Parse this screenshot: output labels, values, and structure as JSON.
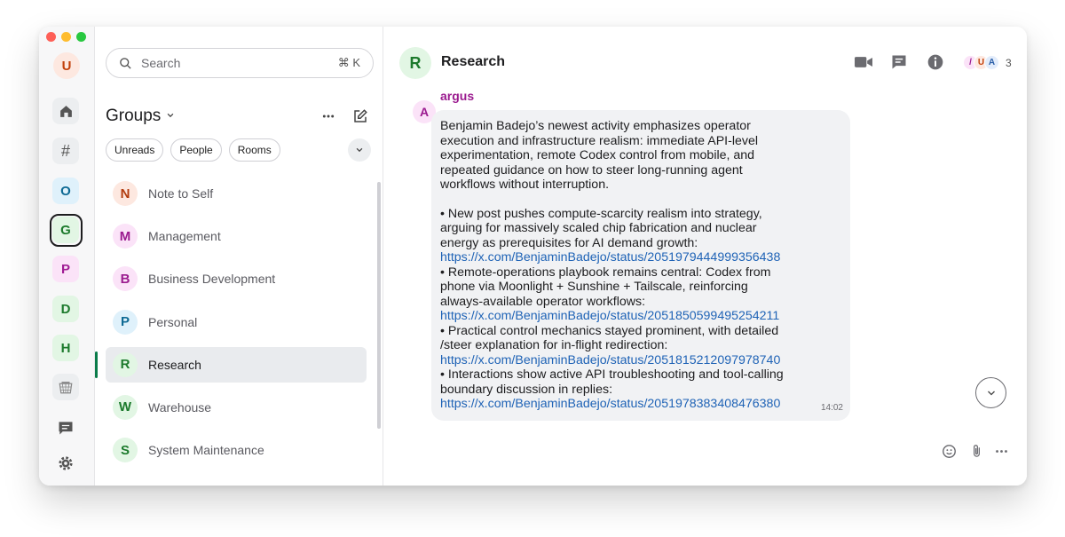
{
  "rail": {
    "user_initial": "U",
    "spaces": [
      {
        "initial": "O"
      },
      {
        "initial": "G"
      },
      {
        "initial": "P"
      },
      {
        "initial": "D"
      },
      {
        "initial": "H"
      }
    ],
    "hash_glyph": "#"
  },
  "sidebar": {
    "search": {
      "placeholder": "Search",
      "shortcut": "⌘ K"
    },
    "title": "Groups",
    "filters": [
      "Unreads",
      "People",
      "Rooms"
    ],
    "rooms": [
      {
        "initial": "N",
        "name": "Note to Self"
      },
      {
        "initial": "M",
        "name": "Management"
      },
      {
        "initial": "B",
        "name": "Business Development"
      },
      {
        "initial": "P",
        "name": "Personal"
      },
      {
        "initial": "R",
        "name": "Research",
        "active": true
      },
      {
        "initial": "W",
        "name": "Warehouse"
      },
      {
        "initial": "S",
        "name": "System Maintenance"
      }
    ]
  },
  "header": {
    "room_initial": "R",
    "room_name": "Research",
    "member_initials": [
      "/",
      "U",
      "A"
    ],
    "member_count": "3"
  },
  "message": {
    "sender_initial": "A",
    "sender": "argus",
    "intro": [
      "Benjamin Badejo’s newest activity emphasizes operator",
      "execution and infrastructure realism: immediate API-level",
      "experimentation, remote Codex control from mobile, and",
      "repeated guidance on how to steer long-running agent",
      "workflows without interruption."
    ],
    "bullets": [
      {
        "lines": [
          "• New post pushes compute-scarcity realism into strategy,",
          "arguing for massively scaled chip fabrication and nuclear",
          "energy as prerequisites for AI demand growth:"
        ],
        "link": "https://x.com/BenjaminBadejo/status/2051979444999356438"
      },
      {
        "lines": [
          "• Remote-operations playbook remains central: Codex from",
          "phone via Moonlight + Sunshine + Tailscale, reinforcing",
          "always-available operator workflows:"
        ],
        "link": "https://x.com/BenjaminBadejo/status/2051850599495254211"
      },
      {
        "lines": [
          "• Practical control mechanics stayed prominent, with detailed",
          "/steer explanation for in-flight redirection:"
        ],
        "link": "https://x.com/BenjaminBadejo/status/2051815212097978740"
      },
      {
        "lines": [
          "• Interactions show active API troubleshooting and tool-calling",
          "boundary discussion in replies:"
        ],
        "link": "https://x.com/BenjaminBadejo/status/2051978383408476380"
      }
    ],
    "time": "14:02"
  },
  "colors": {
    "accent_green": "#0a7c4a",
    "link": "#1f63b6",
    "sender": "#9b1b8f"
  }
}
